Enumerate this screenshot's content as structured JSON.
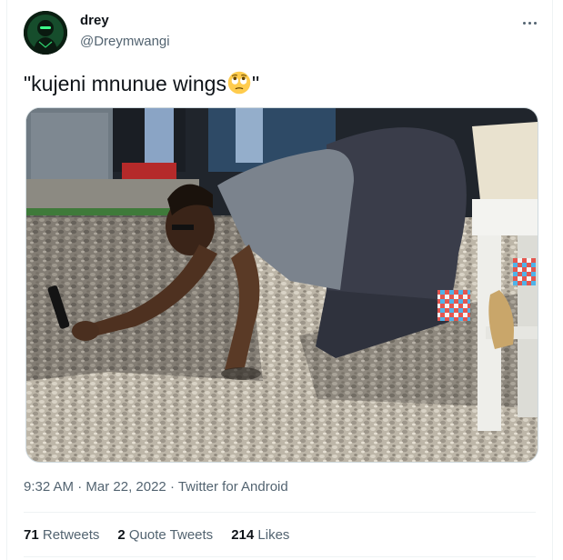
{
  "author": {
    "name": "drey",
    "handle": "@Dreymwangi"
  },
  "tweet": {
    "text_before": "\"kujeni mnunue wings",
    "emoji_icon": "face-with-rolling-eyes",
    "text_after": "\""
  },
  "meta": {
    "time": "9:32 AM",
    "sep1": " · ",
    "date": "Mar 22, 2022",
    "sep2": " · ",
    "source": "Twitter for Android"
  },
  "stats": [
    {
      "count": "71",
      "label": "Retweets"
    },
    {
      "count": "2",
      "label": "Quote Tweets"
    },
    {
      "count": "214",
      "label": "Likes"
    }
  ],
  "colors": {
    "text_primary": "#0f1419",
    "text_secondary": "#536471",
    "divider": "#eff3f4"
  }
}
